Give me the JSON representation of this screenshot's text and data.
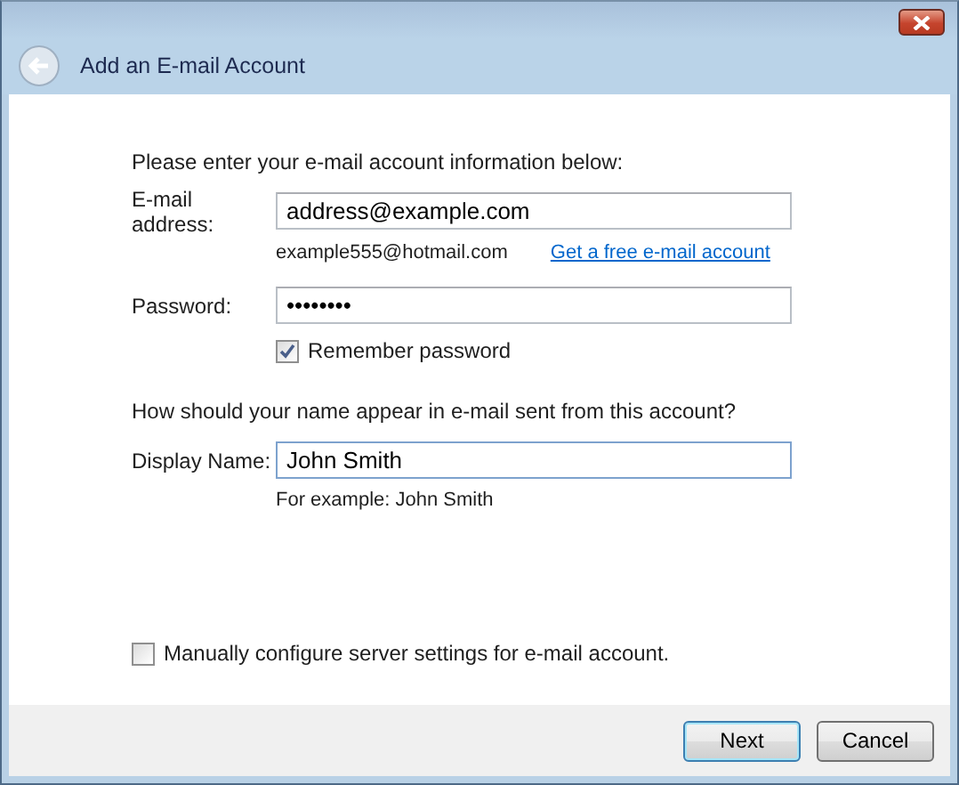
{
  "window": {
    "title": "Add an E-mail Account"
  },
  "intro": "Please enter your e-mail account information below:",
  "email": {
    "label": "E-mail address:",
    "value": "address@example.com",
    "hint": "example555@hotmail.com",
    "link": "Get a free e-mail account"
  },
  "password": {
    "label": "Password:",
    "value": "••••••••"
  },
  "remember_password": {
    "label": "Remember password",
    "checked": true
  },
  "name_question": "How should your name appear in e-mail sent from this account?",
  "display_name": {
    "label": "Display Name:",
    "value": "John Smith",
    "focused": true,
    "hint": "For example: John Smith"
  },
  "manual_config": {
    "label": "Manually configure server settings for e-mail account.",
    "checked": false
  },
  "buttons": [
    {
      "label": "Next",
      "default": true
    },
    {
      "label": "Cancel",
      "default": false
    }
  ]
}
